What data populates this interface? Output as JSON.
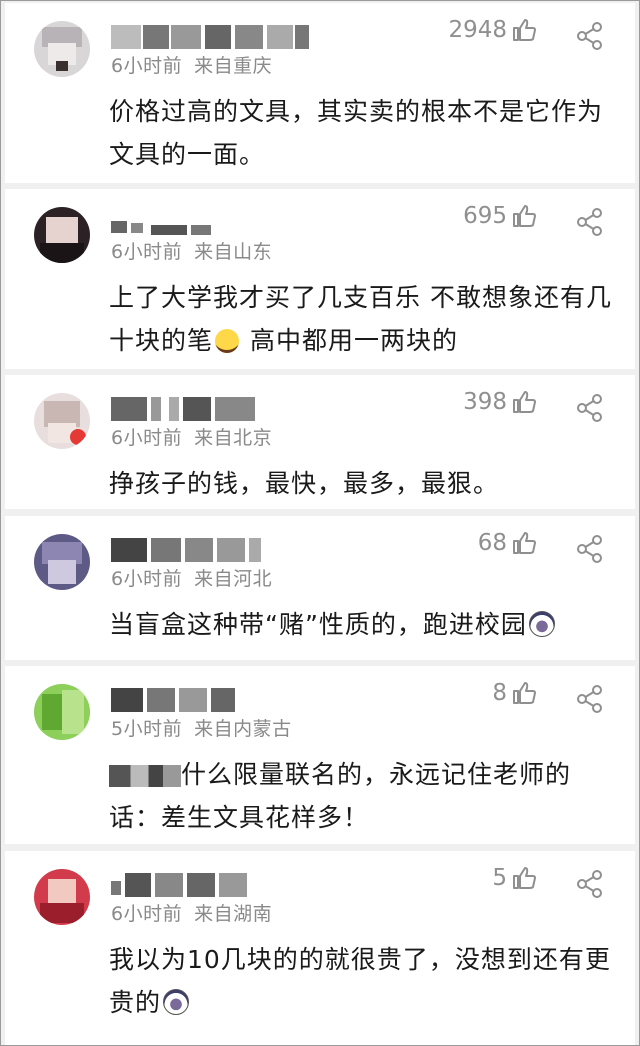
{
  "comments": [
    {
      "likes": "2948",
      "time": "6小时前",
      "location": "来自重庆",
      "text": "价格过高的文具，其实卖的根本不是它作为文具的一面。"
    },
    {
      "likes": "695",
      "time": "6小时前",
      "location": "来自山东",
      "text_a": "上了大学我才买了几支百乐 不敢想象还有几十块的笔",
      "emoji": "laughing-crying-emoji",
      "text_b": " 高中都用一两块的"
    },
    {
      "likes": "398",
      "time": "6小时前",
      "location": "来自北京",
      "text": "挣孩子的钱，最快，最多，最狠。"
    },
    {
      "likes": "68",
      "time": "6小时前",
      "location": "来自河北",
      "text": "当盲盒这种带“赌”性质的，跑进校园",
      "emoji": "shocked-emoji"
    },
    {
      "likes": "8",
      "time": "5小时前",
      "location": "来自内蒙古",
      "text": "什么限量联名的，永远记住老师的话：差生文具花样多！"
    },
    {
      "likes": "5",
      "time": "6小时前",
      "location": "来自湖南",
      "text": "我以为10几块的的就很贵了，没想到还有更贵的",
      "emoji": "shocked-emoji"
    }
  ],
  "icons": {
    "like": "thumbs-up-icon",
    "share": "share-icon"
  },
  "colors": {
    "meta_gray": "#8a8a8a",
    "text": "#1a1a1a",
    "separator": "#f0f0f0"
  }
}
